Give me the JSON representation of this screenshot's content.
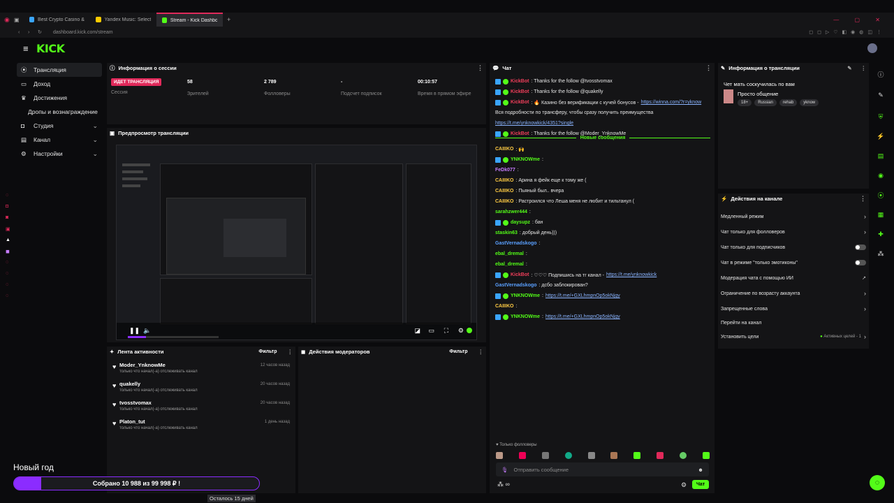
{
  "browser": {
    "tabs": [
      {
        "label": "Best Crypto Casino & Bit",
        "active": false
      },
      {
        "label": "Yandex Music: Selecte",
        "active": false
      },
      {
        "label": "Stream - Kick Dashboard",
        "active": true
      }
    ],
    "url": "dashboard.kick.com/stream"
  },
  "brand": {
    "logo": "KICK",
    "accent": "#53fc18",
    "live": "#e0295a"
  },
  "nav": {
    "items": [
      {
        "label": "Трансляция",
        "icon": "broadcast-icon",
        "chevron": false,
        "active": true
      },
      {
        "label": "Доход",
        "icon": "wallet-icon",
        "chevron": false,
        "active": false
      },
      {
        "label": "Достижения",
        "icon": "trophy-icon",
        "chevron": false,
        "active": false
      },
      {
        "label": "Дропы и вознаграждение",
        "icon": "",
        "chevron": false,
        "active": false
      },
      {
        "label": "Студия",
        "icon": "studio-icon",
        "chevron": true,
        "active": false
      },
      {
        "label": "Канал",
        "icon": "channel-icon",
        "chevron": true,
        "active": false
      },
      {
        "label": "Настройки",
        "icon": "gear-icon",
        "chevron": true,
        "active": false
      }
    ]
  },
  "session": {
    "title": "Информация о сессии",
    "live_badge": "ИДЕТ ТРАНСЛЯЦИЯ",
    "session_label": "Сессия",
    "viewers": "58",
    "viewers_label": "Зрителей",
    "followers": "2 789",
    "followers_label": "Фолловеры",
    "subs": "-",
    "subs_label": "Подсчет подписок",
    "time": "00:10:57",
    "time_label": "Время в прямом эфире"
  },
  "preview": {
    "title": "Предпросмотр трансляции",
    "goal_title": "Новый год",
    "goal_progress": "Собрано 10 988 из 99 998 ₽ !"
  },
  "activity": {
    "title": "Лента активности",
    "filter": "Фильтр",
    "items": [
      {
        "name": "Moder_YnknowMe",
        "sub": "только что начал(-а) отслеживать канал",
        "time": "12 часов назад"
      },
      {
        "name": "quakelly",
        "sub": "только что начал(-а) отслеживать канал",
        "time": "20 часов назад"
      },
      {
        "name": "tvosstvomax",
        "sub": "только что начал(-а) отслеживать канал",
        "time": "20 часов назад"
      },
      {
        "name": "Platon_tut",
        "sub": "только что начал(-а) отслеживать канал",
        "time": "1 день назад"
      }
    ]
  },
  "mod_actions": {
    "title": "Действия модераторов",
    "filter": "Фильтр"
  },
  "chat": {
    "title": "Чат",
    "new_messages": "Новые сообщения",
    "lines": [
      {
        "user": "KickBot",
        "ucolor": "#f03e5a",
        "text": ": Thanks for the follow @tvosstvomax",
        "link": "",
        "badges": true
      },
      {
        "user": "KickBot",
        "ucolor": "#f03e5a",
        "text": ": Thanks for the follow @quakelly",
        "link": "",
        "badges": true
      },
      {
        "user": "KickBot",
        "ucolor": "#f03e5a",
        "text": ": 🔥 Казино без верификации с кучей бонусов - ",
        "link": "https://winna.com/?r=yknow",
        "badges": true
      },
      {
        "user": "",
        "ucolor": "#fff",
        "text": "Вся подробности по трансферу, чтобы сразу получить преимущества",
        "link": "",
        "badges": false
      },
      {
        "user": "",
        "ucolor": "#fff",
        "text": "",
        "link": "https://t.me/ynknowkick/4351?single",
        "badges": false
      },
      {
        "user": "KickBot",
        "ucolor": "#f03e5a",
        "text": ": Thanks for the follow @Moder_YnknowMe",
        "link": "",
        "badges": true
      }
    ],
    "new_lines": [
      {
        "user": "CAIIIKO",
        "ucolor": "#ffcc44",
        "text": ": 🙌",
        "link": "",
        "badges": false
      },
      {
        "user": "YNKNOWme",
        "ucolor": "#53fc18",
        "text": ":",
        "link": "",
        "badges": true
      },
      {
        "user": "FeDk077",
        "ucolor": "#c77dff",
        "text": ":",
        "link": "",
        "badges": false
      },
      {
        "user": "CAIIIKO",
        "ucolor": "#ffcc44",
        "text": ": Арина я фейк еще к тому же (",
        "link": "",
        "badges": false
      },
      {
        "user": "CAIIIKO",
        "ucolor": "#ffcc44",
        "text": ": Пьяный был.. вчера",
        "link": "",
        "badges": false
      },
      {
        "user": "CAIIIKO",
        "ucolor": "#ffcc44",
        "text": ": Растроился что Леша меня не любит и тильтанул (",
        "link": "",
        "badges": false
      },
      {
        "user": "sarahzwer444",
        "ucolor": "#53fc18",
        "text": ":",
        "link": "",
        "badges": false
      },
      {
        "user": "daysupz",
        "ucolor": "#53fc18",
        "text": ": бан",
        "link": "",
        "badges": true
      },
      {
        "user": "staskin63",
        "ucolor": "#53fc18",
        "text": ": добрый день)))",
        "link": "",
        "badges": false
      },
      {
        "user": "GastVernadskogo",
        "ucolor": "#5aa0ff",
        "text": ":",
        "link": "",
        "badges": false
      },
      {
        "user": "ebal_dremal",
        "ucolor": "#53fc18",
        "text": ":",
        "link": "",
        "badges": false
      },
      {
        "user": "ebal_dremal",
        "ucolor": "#53fc18",
        "text": ":",
        "link": "",
        "badges": false
      },
      {
        "user": "KickBot",
        "ucolor": "#f03e5a",
        "text": ": ♡♡♡ Подпишись на тг канал - ",
        "link": "https://t.me/ynknowkick",
        "badges": true
      },
      {
        "user": "GastVernadskogo",
        "ucolor": "#5aa0ff",
        "text": ": дсбо заблокирован?",
        "link": "",
        "badges": false
      },
      {
        "user": "YNKNOWme",
        "ucolor": "#53fc18",
        "text": ": ",
        "link": "https://t.me/+GXLhmpnOp5okNjgy",
        "badges": true
      },
      {
        "user": "CAIIIKO",
        "ucolor": "#ffcc44",
        "text": ":",
        "link": "",
        "badges": false
      },
      {
        "user": "YNKNOWme",
        "ucolor": "#53fc18",
        "text": ": ",
        "link": "https://t.me/+GXLhmpnOp5okNjgy",
        "badges": true
      }
    ],
    "followers_only": "Только фолловеры",
    "input_placeholder": "Отправить сообщение",
    "send": "Чат"
  },
  "stream_info": {
    "title": "Информация о трансляции",
    "stream_title": "Чет мать соскучилась по вам",
    "category": "Просто общение",
    "tags": [
      "18+",
      "Russian",
      "rehab",
      "yknow"
    ]
  },
  "channel_actions": {
    "title": "Действия на канале",
    "rows": [
      {
        "label": "Медленный режим",
        "kind": "chevron"
      },
      {
        "label": "Чат только для фолловеров",
        "kind": "chevron"
      },
      {
        "label": "Чат только для подписчиков",
        "kind": "toggle"
      },
      {
        "label": "Чат в режиме \"только эмотиконы\"",
        "kind": "toggle"
      },
      {
        "label": "Модерация чата с помощью ИИ",
        "kind": "external"
      },
      {
        "label": "Ограничение по возрасту аккаунта",
        "kind": "chevron"
      },
      {
        "label": "Запрещенные слова",
        "kind": "chevron"
      },
      {
        "label": "Перейти на канал",
        "kind": "none"
      },
      {
        "label": "Установить цели",
        "kind": "goals"
      }
    ],
    "goals_status": "Активных целей - 1"
  },
  "overlay": {
    "goal_title": "Новый год",
    "goal_progress": "Собрано 10 988  из 99 998 ₽ !",
    "goal_fraction": 0.11,
    "days_left": "Осталось 15 дней"
  }
}
